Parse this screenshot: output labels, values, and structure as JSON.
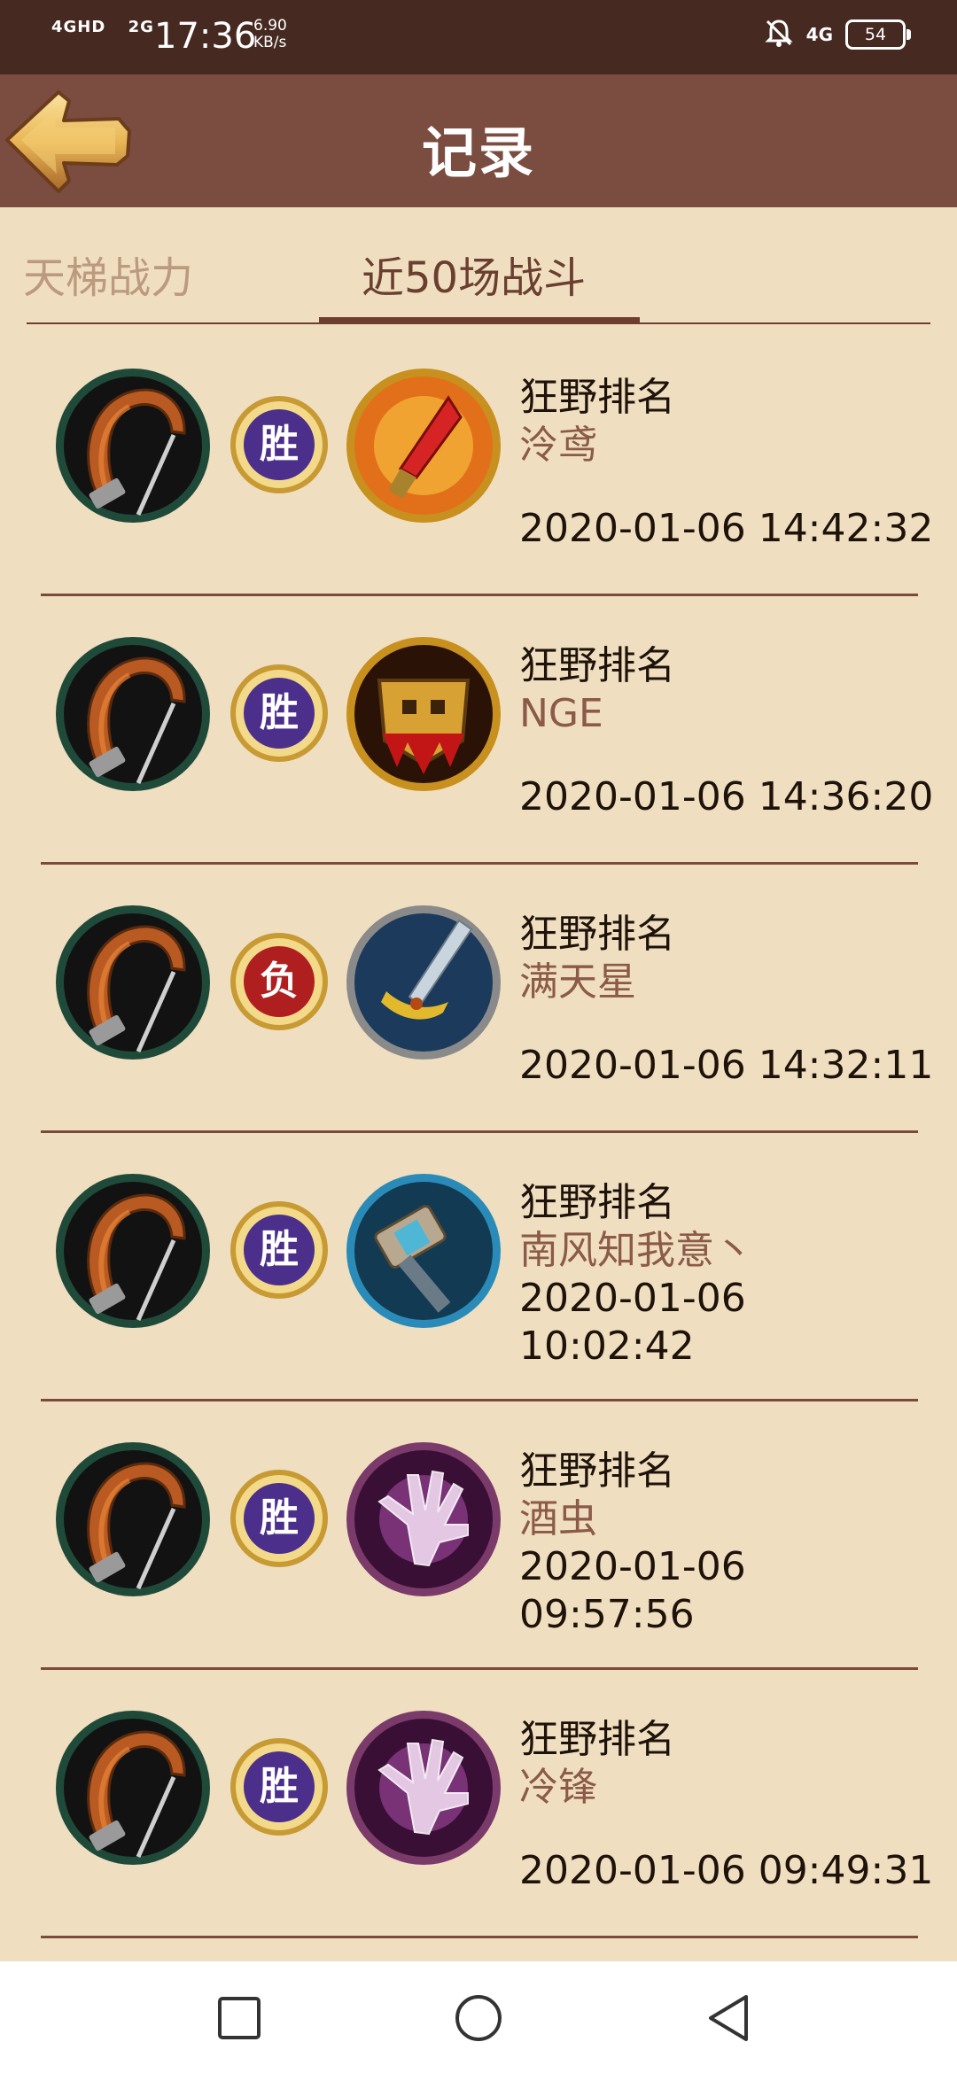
{
  "status_bar": {
    "signal1": "4GHD",
    "signal2": "2G",
    "time": "17:36",
    "speed_value": "6.90",
    "speed_unit": "KB/s",
    "network": "4G",
    "battery": "54"
  },
  "header": {
    "title": "记录",
    "back_icon": "back-arrow-icon"
  },
  "tabs": [
    {
      "label": "天梯战力",
      "active": false
    },
    {
      "label": "近50场战斗",
      "active": true
    }
  ],
  "battles": [
    {
      "mode": "狂野排名",
      "opponent": "泠鸢",
      "time": "2020-01-06 14:42:32",
      "result": "胜",
      "opponent_icon": "flame-crystal-icon",
      "result_color": "#4b2f8a"
    },
    {
      "mode": "狂野排名",
      "opponent": "NGE",
      "time": "2020-01-06 14:36:20",
      "result": "胜",
      "opponent_icon": "skull-shield-icon",
      "result_color": "#4b2f8a"
    },
    {
      "mode": "狂野排名",
      "opponent": "满天星",
      "time": "2020-01-06 14:32:11",
      "result": "负",
      "opponent_icon": "sword-icon",
      "result_color": "#b01f1f"
    },
    {
      "mode": "狂野排名",
      "opponent": "南风知我意丶",
      "time": "2020-01-06 10:02:42",
      "result": "胜",
      "opponent_icon": "hammer-icon",
      "result_color": "#4b2f8a"
    },
    {
      "mode": "狂野排名",
      "opponent": "酒虫",
      "time": "2020-01-06 09:57:56",
      "result": "胜",
      "opponent_icon": "magic-hand-icon",
      "result_color": "#4b2f8a"
    },
    {
      "mode": "狂野排名",
      "opponent": "冷锋",
      "time": "2020-01-06 09:49:31",
      "result": "胜",
      "opponent_icon": "magic-hand-icon",
      "result_color": "#4b2f8a"
    }
  ],
  "nav": [
    "recent-apps-icon",
    "home-icon",
    "back-icon"
  ]
}
